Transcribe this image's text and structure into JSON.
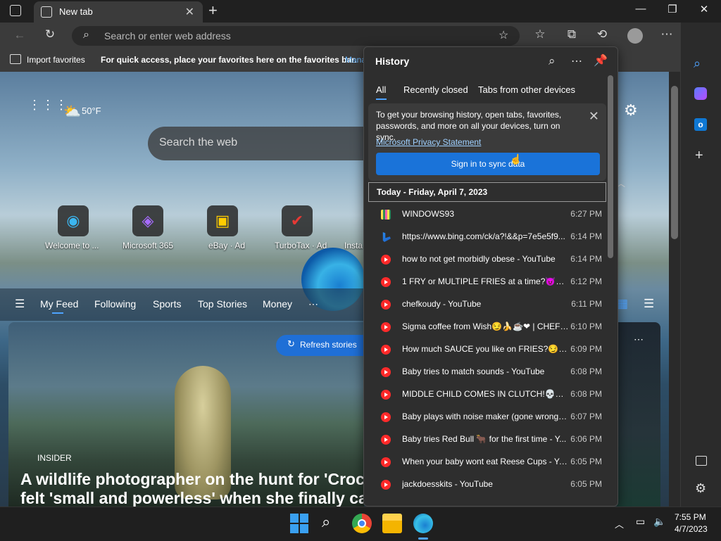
{
  "browser": {
    "tab_title": "New tab",
    "url_placeholder": "Search or enter web address",
    "import_favorites": "Import favorites",
    "favorites_message": "For quick access, place your favorites here on the favorites bar.",
    "manage_link": "Mana"
  },
  "newtab": {
    "weather": "50°F",
    "search_placeholder": "Search the web",
    "tiles": [
      {
        "label": "Welcome to ..."
      },
      {
        "label": "Microsoft 365"
      },
      {
        "label": "eBay · Ad"
      },
      {
        "label": "TurboTax · Ad"
      },
      {
        "label": "Insta"
      }
    ],
    "feed_tabs": [
      "My Feed",
      "Following",
      "Sports",
      "Top Stories",
      "Money"
    ],
    "refresh_label": "Refresh stories",
    "story_source": "INSIDER",
    "story_headline_1": "A wildlife photographer on the hunt for 'Croc",
    "story_headline_2": "felt 'small and powerless' when she finally ca"
  },
  "history": {
    "title": "History",
    "tabs": [
      "All",
      "Recently closed",
      "Tabs from other devices"
    ],
    "sync_text": "To get your browsing history, open tabs, favorites, passwords, and more on all your devices, turn on sync.",
    "privacy_link": "Microsoft Privacy Statement",
    "signin_button": "Sign in to sync data",
    "day_header": "Today - Friday, April 7, 2023",
    "items": [
      {
        "icon": "windows93",
        "title": "WINDOWS93",
        "time": "6:27 PM"
      },
      {
        "icon": "bing",
        "title": "https://www.bing.com/ck/a?!&&p=7e5e5f9...",
        "time": "6:14 PM"
      },
      {
        "icon": "youtube",
        "title": "how to not get morbidly obese - YouTube",
        "time": "6:14 PM"
      },
      {
        "icon": "youtube",
        "title": "1 FRY or MULTIPLE FRIES at a time?😈🔥 ...",
        "time": "6:12 PM"
      },
      {
        "icon": "youtube",
        "title": "chefkoudy - YouTube",
        "time": "6:11 PM"
      },
      {
        "icon": "youtube",
        "title": "Sigma coffee from Wish😏🍌☕❤ | CHEFK...",
        "time": "6:10 PM"
      },
      {
        "icon": "youtube",
        "title": "How much SAUCE you like on FRIES?😏🍌 ...",
        "time": "6:09 PM"
      },
      {
        "icon": "youtube",
        "title": "Baby tries to match sounds - YouTube",
        "time": "6:08 PM"
      },
      {
        "icon": "youtube",
        "title": "MIDDLE CHILD COMES IN CLUTCH!💀🤩 ...",
        "time": "6:08 PM"
      },
      {
        "icon": "youtube",
        "title": "Baby plays with noise maker (gone wrong) ...",
        "time": "6:07 PM"
      },
      {
        "icon": "youtube",
        "title": "Baby tries Red Bull 🐂 for the first time - Y...",
        "time": "6:06 PM"
      },
      {
        "icon": "youtube",
        "title": "When your baby wont eat Reese Cups - Yo...",
        "time": "6:05 PM"
      },
      {
        "icon": "youtube",
        "title": "jackdoesskits - YouTube",
        "time": "6:05 PM"
      }
    ]
  },
  "taskbar": {
    "time": "7:55 PM",
    "date": "4/7/2023"
  },
  "colors": {
    "accent": "#1a73d9",
    "youtube_red": "#ff2a2a",
    "link": "#9fd0ff"
  }
}
